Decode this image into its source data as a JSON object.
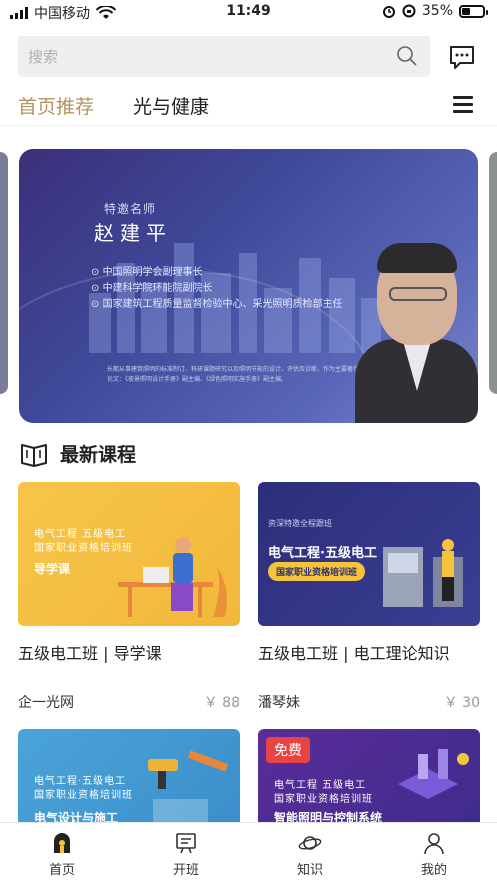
{
  "status_bar": {
    "carrier": "中国移动",
    "time": "11:49",
    "battery": "35%"
  },
  "search": {
    "placeholder": "搜索"
  },
  "nav": {
    "tab_home": "首页推荐",
    "tab_health": "光与健康"
  },
  "banner": {
    "label": "特邀名师",
    "name": "赵建平",
    "roles": [
      "中国照明学会副理事长",
      "中建科学院环能院副院长",
      "国家建筑工程质量监督检验中心、采光照明质检部主任"
    ],
    "desc": "长期从事建筑照明的标准制订、科研课题研究以及照明节能的设计、评估及诊断，作为主要著作及论文：《夜景照明设计手册》副主编、《绿色照明实施手册》副主编。"
  },
  "section": {
    "title": "最新课程"
  },
  "courses": [
    {
      "title": "五级电工班 | 导学课",
      "author": "企一光网",
      "price": "￥ 88",
      "thumb_lines": [
        "电气工程 五级电工",
        "国家职业资格培训班"
      ],
      "thumb_sub": "导学课"
    },
    {
      "title": "五级电工班 | 电工理论知识",
      "author": "潘琴妹",
      "price": "￥ 30",
      "thumb_top": "资深特邀全程跟班",
      "thumb_big": "电气工程·五级电工",
      "thumb_pill": "国家职业资格培训班"
    },
    {
      "thumb_lines": [
        "电气工程·五级电工",
        "国家职业资格培训班"
      ],
      "thumb_sub": "电气设计与施工"
    },
    {
      "badge": "免费",
      "thumb_lines": [
        "电气工程 五级电工",
        "国家职业资格培训班"
      ],
      "thumb_sub": "智能照明与控制系统"
    }
  ],
  "bottom_nav": [
    {
      "label": "首页"
    },
    {
      "label": "开班"
    },
    {
      "label": "知识"
    },
    {
      "label": "我的"
    }
  ],
  "colors": {
    "accent": "#b5935e",
    "free_badge": "#e94444"
  }
}
